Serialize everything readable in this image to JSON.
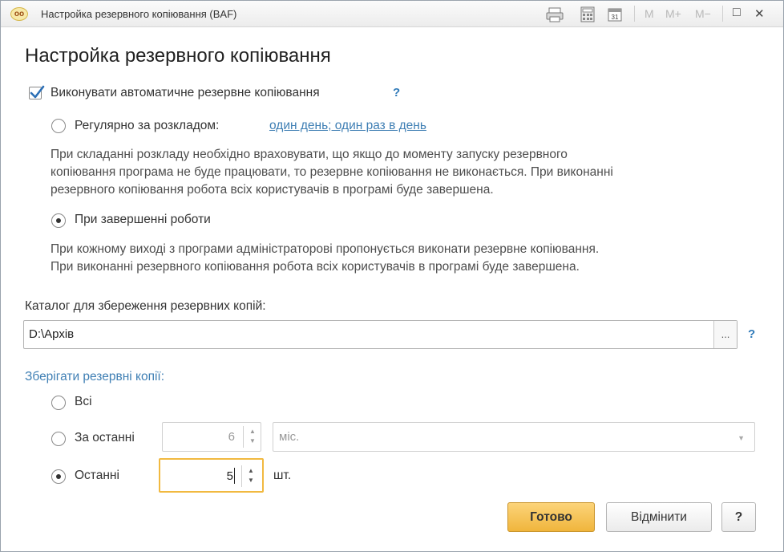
{
  "window": {
    "app_icon_text": "oo",
    "title": "Настройка резервного копіювання  (BAF)",
    "toolbar_m": "M",
    "toolbar_m_plus": "M+",
    "toolbar_m_minus": "M−",
    "maximize_icon": "□",
    "close_icon": "✕"
  },
  "form": {
    "title": "Настройка резервного копіювання",
    "auto_backup": {
      "label": "Виконувати автоматичне резервне копіювання",
      "checked": true,
      "help": "?"
    },
    "schedule_option": {
      "label": "Регулярно за розкладом:",
      "link": "один день; один раз в день",
      "selected": false,
      "description_1": "При складанні розкладу необхідно враховувати, що якщо до моменту запуску резервного",
      "description_2": "копіювання програма не буде працювати, то резервне копіювання не виконається. При виконанні",
      "description_3": "резервного копіювання робота всіх користувачів в програмі буде завершена."
    },
    "on_exit_option": {
      "label": "При завершенні роботи",
      "selected": true,
      "description_1": "При кожному виході з програми адміністраторові пропонується виконати резервне копіювання.",
      "description_2": "При виконанні резервного копіювання робота всіх користувачів в програмі буде завершена."
    },
    "directory": {
      "label": "Каталог для збереження резервних копій:",
      "value": "D:\\Архів",
      "browse": "...",
      "help": "?"
    },
    "retention": {
      "title": "Зберігати резервні копії:",
      "all_label": "Всі",
      "last_period_label": "За останні",
      "last_period_value": "6",
      "period_unit_value": "міс.",
      "last_count_label": "Останні",
      "last_count_value": "5",
      "count_unit": "шт.",
      "selected": "last_count"
    },
    "buttons": {
      "ok": "Готово",
      "cancel": "Відмінити",
      "help": "?"
    }
  }
}
